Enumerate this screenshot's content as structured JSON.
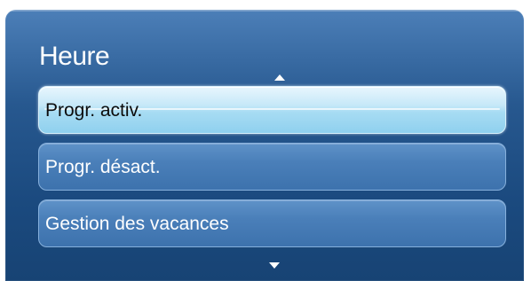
{
  "menu": {
    "title": "Heure",
    "items": [
      {
        "label": "Progr. activ.",
        "selected": true
      },
      {
        "label": "Progr. désact.",
        "selected": false
      },
      {
        "label": "Gestion des vacances",
        "selected": false
      }
    ],
    "scroll_up_icon": "triangle-up",
    "scroll_down_icon": "triangle-down"
  },
  "colors": {
    "panel": "#27588f",
    "item": "#4a7fb9",
    "selected_item": "#c6e8f8",
    "text": "#ffffff",
    "selected_text": "#0c0c0c"
  }
}
